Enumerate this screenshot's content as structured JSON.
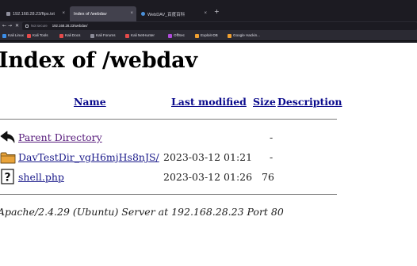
{
  "browser": {
    "tabs": [
      {
        "title": "192.168.28.23/ftps.txt",
        "active": false
      },
      {
        "title": "Index of /webdav",
        "active": true
      },
      {
        "title": "WebDAV_百度百科",
        "active": false
      }
    ],
    "new_tab_label": "+",
    "close_glyph": "×",
    "nav": {
      "back": "←",
      "forward": "→",
      "reload": "✕"
    },
    "url_security": "Not secure",
    "url": "192.168.28.23/webdav/",
    "bookmarks": [
      {
        "label": "Kali Linux",
        "color": "#3b8ee8"
      },
      {
        "label": "Kali Tools",
        "color": "#e64a4a"
      },
      {
        "label": "Kali Docs",
        "color": "#e64a4a"
      },
      {
        "label": "Kali Forums",
        "color": "#8a8a96"
      },
      {
        "label": "Kali NetHunter",
        "color": "#e64a4a"
      },
      {
        "label": "OffSec",
        "color": "#b04adb"
      },
      {
        "label": "Exploit-DB",
        "color": "#f0a030"
      },
      {
        "label": "Google Hackin...",
        "color": "#f0a030"
      }
    ]
  },
  "page": {
    "title": "Index of /webdav",
    "columns": {
      "name": "Name",
      "last_modified": "Last modified",
      "size": "Size",
      "description": "Description"
    },
    "rows": [
      {
        "icon": "back-arrow-icon",
        "name": "Parent Directory",
        "modified": "",
        "size": "-",
        "description": ""
      },
      {
        "icon": "folder-icon",
        "name": "DavTestDir_vgH6mjHs8nJS/",
        "modified": "2023-03-12 01:21",
        "size": "-",
        "description": ""
      },
      {
        "icon": "unknown-file-icon",
        "name": "shell.php",
        "modified": "2023-03-12 01:26",
        "size": "76",
        "description": ""
      }
    ],
    "footer": "Apache/2.4.29 (Ubuntu) Server at 192.168.28.23 Port 80"
  }
}
